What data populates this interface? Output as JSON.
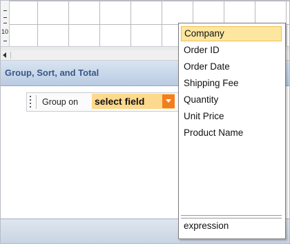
{
  "ruler": {
    "number": "10"
  },
  "panel": {
    "title": "Group, Sort, and Total"
  },
  "group_row": {
    "label": "Group on",
    "field_value": "select field"
  },
  "dropdown": {
    "items": [
      "Company",
      "Order ID",
      "Order Date",
      "Shipping Fee",
      "Quantity",
      "Unit Price",
      "Product Name"
    ],
    "selected": "Company",
    "expression_label": "expression"
  },
  "colors": {
    "selected_bg": "#fde6a0",
    "dropdown_button": "#f47e1e",
    "field_bg": "#fcd98c",
    "title_text": "#3a5787"
  }
}
